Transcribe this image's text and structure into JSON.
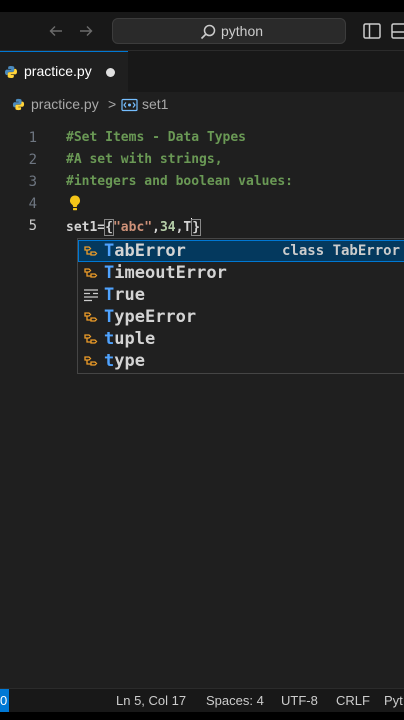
{
  "titlebar": {
    "back_icon": "arrow-left-icon",
    "forward_icon": "arrow-right-icon",
    "search_icon": "search-icon",
    "search_text": "python",
    "layout_icon": "toggle-sidebar-icon"
  },
  "tab": {
    "icon": "python-file-icon",
    "label": "practice.py",
    "dirty": true
  },
  "breadcrumb": {
    "file": "practice.py",
    "separator": ">",
    "symbol_icon": "variable-icon",
    "symbol": "set1"
  },
  "editor": {
    "active_line": 5,
    "lines": [
      {
        "number": "1",
        "text": "#Set Items - Data Types"
      },
      {
        "number": "2",
        "text": "#A set with strings,"
      },
      {
        "number": "3",
        "text": "#integers and boolean values:"
      },
      {
        "number": "4",
        "text": ""
      },
      {
        "number": "5",
        "parts": {
          "a": "set1=",
          "b": "{",
          "c": "\"abc\"",
          "d": ",",
          "e": "34",
          "f": ",T",
          "g": "}"
        }
      }
    ],
    "lightbulb_icon": "lightbulb-icon"
  },
  "suggestions": {
    "items": [
      {
        "match": "T",
        "rest": "abError",
        "kind": "class-icon",
        "detail": "class TabError",
        "selected": true
      },
      {
        "match": "T",
        "rest": "imeoutError",
        "kind": "class-icon"
      },
      {
        "match": "T",
        "rest": "rue",
        "kind": "keyword-icon"
      },
      {
        "match": "T",
        "rest": "ypeError",
        "kind": "class-icon"
      },
      {
        "match": "t",
        "rest": "uple",
        "kind": "class-icon"
      },
      {
        "match": "t",
        "rest": "ype",
        "kind": "class-icon"
      }
    ]
  },
  "statusbar": {
    "remote": "0",
    "position": "Ln 5, Col 17",
    "spaces": "Spaces: 4",
    "encoding": "UTF-8",
    "eol": "CRLF",
    "language": "Pyt"
  },
  "colors": {
    "comment": "#6a9955",
    "string": "#ce9178",
    "number": "#b5cea8",
    "accent": "#0078d4",
    "match_highlight": "#4fa3ff"
  }
}
